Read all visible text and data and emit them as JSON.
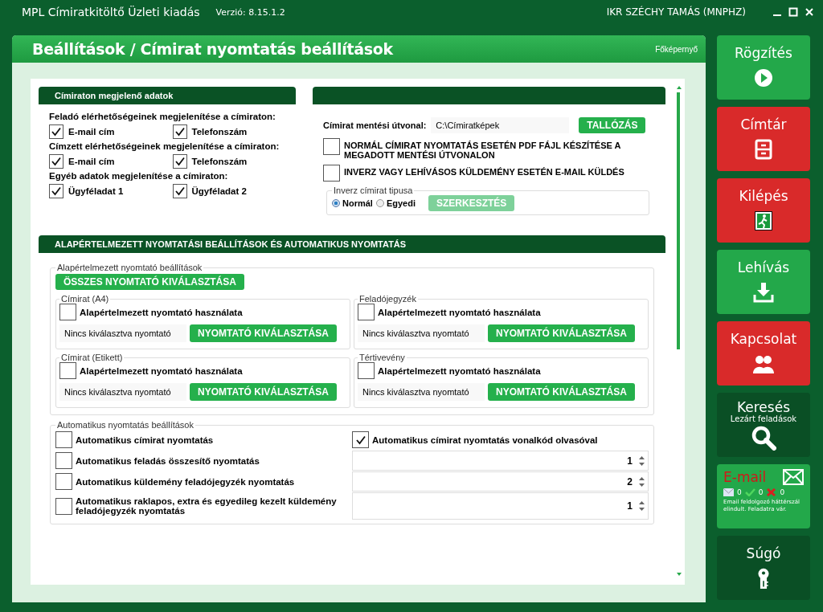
{
  "window": {
    "title": "MPL Címiratkitöltő Üzleti kiadás",
    "version": "Verzió: 8.15.1.2",
    "user": "IKR SZÉCHY TAMÁS  (MNPHZ)"
  },
  "page": {
    "title": "Beállítások / Címirat nyomtatás beállítások",
    "home_link": "Főképernyő"
  },
  "address_data": {
    "title": "Címiraton megjelenő adatok",
    "groups": [
      {
        "label": "Feladó elérhetőségeinek megjelenítése a címiraton:",
        "options": [
          {
            "label": "E-mail cím",
            "checked": true
          },
          {
            "label": "Telefonszám",
            "checked": true
          }
        ]
      },
      {
        "label": "Címzett elérhetőségeinek megjelenítése a címiraton:",
        "options": [
          {
            "label": "E-mail cím",
            "checked": true
          },
          {
            "label": "Telefonszám",
            "checked": true
          }
        ]
      },
      {
        "label": "Egyéb adatok megjelenítése a címiraton:",
        "options": [
          {
            "label": "Ügyféladat 1",
            "checked": true
          },
          {
            "label": "Ügyféladat 2",
            "checked": true
          }
        ]
      }
    ]
  },
  "save": {
    "path_label": "Címirat mentési útvonal:",
    "path_value": "C:\\Címiratképek",
    "browse_button": "TALLÓZÁS",
    "options": [
      {
        "label": "NORMÁL CÍMIRAT NYOMTATÁS ESETÉN PDF FÁJL KÉSZÍTÉSE A MEGADOTT MENTÉSI ÚTVONALON",
        "checked": false
      },
      {
        "label": "INVERZ VAGY LEHÍVÁSOS KÜLDEMÉNY ESETÉN E-MAIL KÜLDÉS",
        "checked": false
      }
    ],
    "inverse": {
      "legend": "Inverz címirat tipusa",
      "radios": [
        {
          "label": "Normál",
          "selected": true
        },
        {
          "label": "Egyedi",
          "selected": false
        }
      ],
      "edit_button": "SZERKESZTÉS",
      "edit_disabled": true
    }
  },
  "printing": {
    "title": "ALAPÉRTELMEZETT NYOMTATÁSI BEÁLLÍTÁSOK ÉS AUTOMATIKUS NYOMTATÁS",
    "printer_group": {
      "legend": "Alapértelmezett nyomtató beállítások",
      "all_button": "ÖSSZES NYOMTATÓ KIVÁLASZTÁSA",
      "printers": [
        {
          "legend": "Címirat (A4)",
          "checkbox_label": "Alapértelmezett nyomtató használata",
          "checked": false,
          "printer": "Nincs kiválasztva nyomtató",
          "button": "NYOMTATÓ KIVÁLASZTÁSA"
        },
        {
          "legend": "Feladójegyzék",
          "checkbox_label": "Alapértelmezett nyomtató használata",
          "checked": false,
          "printer": "Nincs kiválasztva nyomtató",
          "button": "NYOMTATÓ KIVÁLASZTÁSA"
        },
        {
          "legend": "Címirat (Etikett)",
          "checkbox_label": "Alapértelmezett nyomtató használata",
          "checked": false,
          "printer": "Nincs kiválasztva nyomtató",
          "button": "NYOMTATÓ KIVÁLASZTÁSA"
        },
        {
          "legend": "Tértivevény",
          "checkbox_label": "Alapértelmezett nyomtató használata",
          "checked": false,
          "printer": "Nincs kiválasztva nyomtató",
          "button": "NYOMTATÓ KIVÁLASZTÁSA"
        }
      ]
    },
    "auto_group": {
      "legend": "Automatikus nyomtatás beállítások",
      "rows": [
        {
          "label": "Automatikus címirat nyomtatás",
          "checked": false,
          "right": {
            "kind": "checkbox",
            "label": "Automatikus címirat nyomtatás vonalkód olvasóval",
            "checked": true
          }
        },
        {
          "label": "Automatikus feladás összesítő nyomtatás",
          "checked": false,
          "right": {
            "kind": "spinner",
            "value": "1"
          }
        },
        {
          "label": "Automatikus küldemény feladójegyzék nyomtatás",
          "checked": false,
          "right": {
            "kind": "spinner",
            "value": "2"
          }
        },
        {
          "label": "Automatikus raklapos, extra és egyedileg kezelt küldemény feladójegyzék nyomtatás",
          "checked": false,
          "right": {
            "kind": "spinner",
            "value": "1"
          }
        }
      ]
    }
  },
  "sidebar": {
    "items": [
      {
        "kind": "nav",
        "label": "Rögzítés",
        "color": "#23a84a"
      },
      {
        "kind": "nav",
        "label": "Címtár",
        "color": "#d92a2a"
      },
      {
        "kind": "nav",
        "label": "Kilépés",
        "color": "#d92a2a"
      },
      {
        "kind": "nav",
        "label": "Lehívás",
        "color": "#23a84a"
      },
      {
        "kind": "nav",
        "label": "Kapcsolat",
        "color": "#d92a2a"
      },
      {
        "kind": "nav",
        "label": "Keresés",
        "sublabel": "Lezárt feladások",
        "color": "#0a4f25"
      },
      {
        "kind": "status",
        "label": "E-mail",
        "color": "#23a84a",
        "counts": [
          "0",
          "0",
          "0"
        ],
        "message": "Email feldolgozó háttérszál elindult. Feladatra vár."
      },
      {
        "kind": "nav",
        "label": "Súgó",
        "color": "#0a4f25"
      }
    ]
  }
}
